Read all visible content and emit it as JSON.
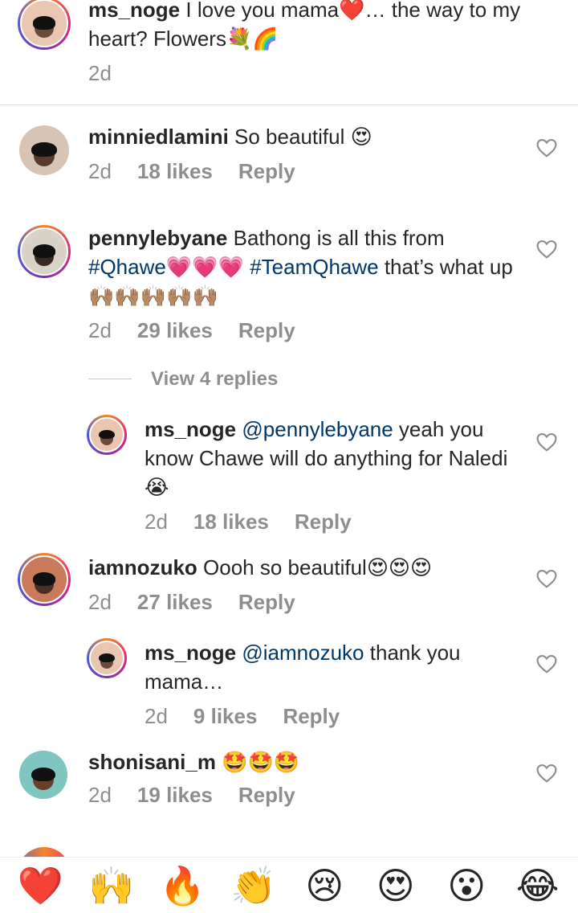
{
  "comments": [
    {
      "username": "ms_noge",
      "text": " I love you mama❤️… the way to my heart? Flowers💐🌈",
      "time": "2d",
      "avatar_color": "#c98a6b"
    },
    {
      "username": "minniedlamini",
      "text": " So beautiful 😍",
      "time": "2d",
      "likes": "18 likes",
      "reply": "Reply",
      "avatar_color": "#3b2a22"
    },
    {
      "username": "pennylebyane",
      "text_a": " Bathong is all this from ",
      "hashtag1": "#Qhawe",
      "text_b": "💗💗💗 ",
      "hashtag2": "#TeamQhawe",
      "text_c": " that’s what up🙌🏽🙌🏽🙌🏽🙌🏽🙌🏽",
      "time": "2d",
      "likes": "29 likes",
      "reply": "Reply",
      "avatar_color": "#d9d3c7"
    },
    {
      "username": "ms_noge",
      "mention": "@pennylebyane",
      "text": " yeah you know Chawe will do anything for Naledi😭",
      "time": "2d",
      "likes": "18 likes",
      "reply": "Reply",
      "avatar_color": "#c98a6b"
    },
    {
      "username": "iamnozuko",
      "text": " Oooh so beautiful😍😍😍",
      "time": "2d",
      "likes": "27 likes",
      "reply": "Reply",
      "avatar_color": "#b3442c"
    },
    {
      "username": "ms_noge",
      "mention": "@iamnozuko",
      "text": " thank you mama…",
      "time": "2d",
      "likes": "9 likes",
      "reply": "Reply",
      "avatar_color": "#c98a6b"
    },
    {
      "username": "shonisani_m",
      "text": " 🤩🤩🤩",
      "time": "2d",
      "likes": "19 likes",
      "reply": "Reply",
      "avatar_color": "#7fc6c0"
    }
  ],
  "view_replies": "View 4 replies",
  "emoji_bar": [
    "❤️",
    "🙌",
    "🔥",
    "👏",
    "😢",
    "😍",
    "😮",
    "😂"
  ]
}
